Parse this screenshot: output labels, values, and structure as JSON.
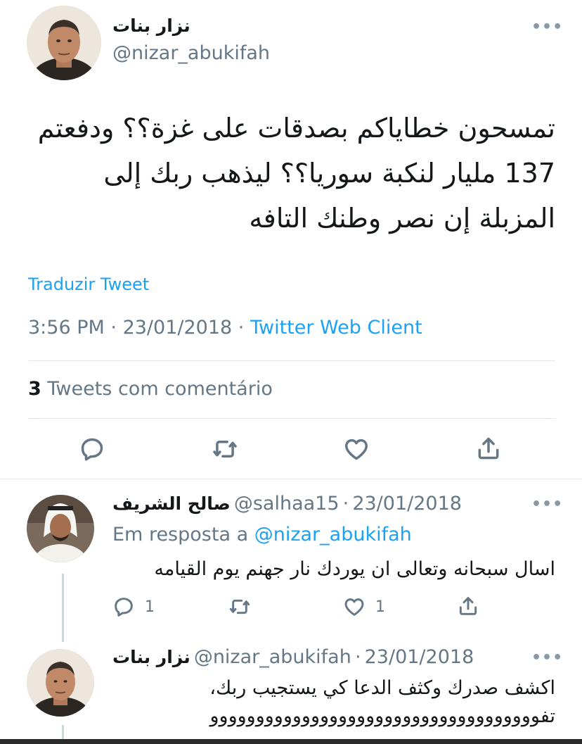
{
  "main_tweet": {
    "author_name": "نزار بنات",
    "author_handle": "@nizar_abukifah",
    "text_lines": [
      "تمسحون خطاياكم بصدقات على غزة؟؟ ودفعتم",
      "137 مليار لنكبة سوريا؟؟ ليذهب ربك إلى",
      "المزبلة إن نصر وطنك التافه"
    ],
    "translate_label": "Traduzir Tweet",
    "time": "3:56 PM",
    "date": "23/01/2018",
    "separator": "·",
    "source": "Twitter Web Client",
    "quote_count": "3",
    "quote_label": "Tweets com comentário",
    "more_icon": "•••"
  },
  "replies": [
    {
      "author_name": "صالح الشريف",
      "author_handle": "@salhaa15",
      "date": "23/01/2018",
      "separator": "·",
      "reply_prefix": "Em resposta a",
      "reply_to": "@nizar_abukifah",
      "text": "اسال سبحانه وتعالى ان يوردك نار جهنم يوم القيامه",
      "reply_count": "1",
      "like_count": "1",
      "more_icon": "•••"
    },
    {
      "author_name": "نزار بنات",
      "author_handle": "@nizar_abukifah",
      "date": "23/01/2018",
      "separator": "·",
      "text_lines": [
        "اكشف صدرك وكثف الدعا كي يستجيب ربك،",
        "تفوووووووووووووووووووووووووووووووووووو"
      ],
      "more_icon": "•••"
    }
  ],
  "icons": {
    "reply": "reply-icon",
    "retweet": "retweet-icon",
    "like": "like-icon",
    "share": "share-icon",
    "more": "more-icon"
  },
  "colors": {
    "accent": "#1da1f2",
    "secondary_text": "#657786",
    "divider": "#e1e8ed",
    "thread_line": "#ccd6dd"
  }
}
